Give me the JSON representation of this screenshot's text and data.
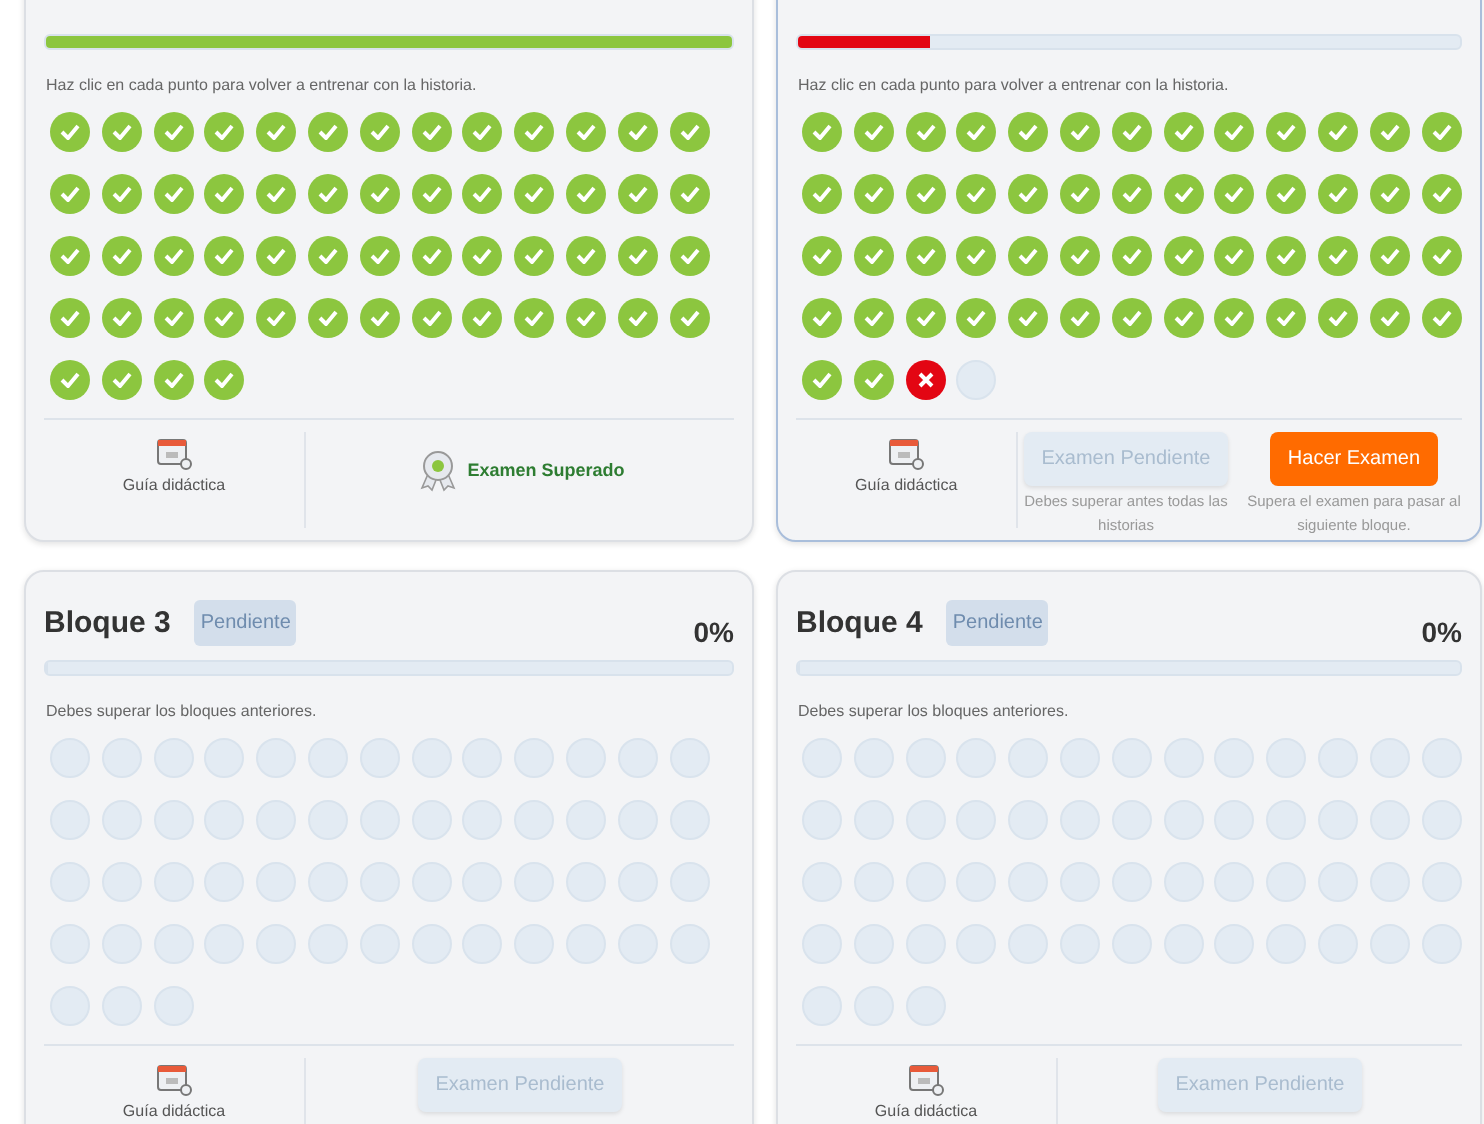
{
  "blocks": [
    {
      "selected": false,
      "progress": {
        "level": 1,
        "color": "#8cc63f"
      },
      "message": "Haz clic en cada punto para volver a entrenar con la historia.",
      "dots": [
        {
          "kind": "passed"
        },
        {
          "kind": "passed"
        },
        {
          "kind": "passed"
        },
        {
          "kind": "passed"
        },
        {
          "kind": "passed"
        },
        {
          "kind": "passed"
        },
        {
          "kind": "passed"
        },
        {
          "kind": "passed"
        },
        {
          "kind": "passed"
        },
        {
          "kind": "passed"
        },
        {
          "kind": "passed"
        },
        {
          "kind": "passed"
        },
        {
          "kind": "passed"
        },
        {
          "kind": "passed"
        },
        {
          "kind": "passed"
        },
        {
          "kind": "passed"
        },
        {
          "kind": "passed"
        },
        {
          "kind": "passed"
        },
        {
          "kind": "passed"
        },
        {
          "kind": "passed"
        },
        {
          "kind": "passed"
        },
        {
          "kind": "passed"
        },
        {
          "kind": "passed"
        },
        {
          "kind": "passed"
        },
        {
          "kind": "passed"
        },
        {
          "kind": "passed"
        },
        {
          "kind": "passed"
        },
        {
          "kind": "passed"
        },
        {
          "kind": "passed"
        },
        {
          "kind": "passed"
        },
        {
          "kind": "passed"
        },
        {
          "kind": "passed"
        },
        {
          "kind": "passed"
        },
        {
          "kind": "passed"
        },
        {
          "kind": "passed"
        },
        {
          "kind": "passed"
        },
        {
          "kind": "passed"
        },
        {
          "kind": "passed"
        },
        {
          "kind": "passed"
        },
        {
          "kind": "passed"
        },
        {
          "kind": "passed"
        },
        {
          "kind": "passed"
        },
        {
          "kind": "passed"
        },
        {
          "kind": "passed"
        },
        {
          "kind": "passed"
        },
        {
          "kind": "passed"
        },
        {
          "kind": "passed"
        },
        {
          "kind": "passed"
        },
        {
          "kind": "passed"
        },
        {
          "kind": "passed"
        },
        {
          "kind": "passed"
        },
        {
          "kind": "passed"
        },
        {
          "kind": "passed"
        },
        {
          "kind": "passed"
        },
        {
          "kind": "passed"
        },
        {
          "kind": "passed"
        }
      ],
      "guide": "Guía didáctica",
      "actions": [
        {
          "kind": "achievement",
          "label": "Examen Superado"
        }
      ]
    },
    {
      "selected": true,
      "progress": {
        "level": 0.2,
        "color": "#e30613"
      },
      "message": "Haz clic en cada punto para volver a entrenar con la historia.",
      "dots": [
        {
          "kind": "passed"
        },
        {
          "kind": "passed"
        },
        {
          "kind": "passed"
        },
        {
          "kind": "passed"
        },
        {
          "kind": "passed"
        },
        {
          "kind": "passed"
        },
        {
          "kind": "passed"
        },
        {
          "kind": "passed"
        },
        {
          "kind": "passed"
        },
        {
          "kind": "passed"
        },
        {
          "kind": "passed"
        },
        {
          "kind": "passed"
        },
        {
          "kind": "passed"
        },
        {
          "kind": "passed"
        },
        {
          "kind": "passed"
        },
        {
          "kind": "passed"
        },
        {
          "kind": "passed"
        },
        {
          "kind": "passed"
        },
        {
          "kind": "passed"
        },
        {
          "kind": "passed"
        },
        {
          "kind": "passed"
        },
        {
          "kind": "passed"
        },
        {
          "kind": "passed"
        },
        {
          "kind": "passed"
        },
        {
          "kind": "passed"
        },
        {
          "kind": "passed"
        },
        {
          "kind": "passed"
        },
        {
          "kind": "passed"
        },
        {
          "kind": "passed"
        },
        {
          "kind": "passed"
        },
        {
          "kind": "passed"
        },
        {
          "kind": "passed"
        },
        {
          "kind": "passed"
        },
        {
          "kind": "passed"
        },
        {
          "kind": "passed"
        },
        {
          "kind": "passed"
        },
        {
          "kind": "passed"
        },
        {
          "kind": "passed"
        },
        {
          "kind": "passed"
        },
        {
          "kind": "passed"
        },
        {
          "kind": "passed"
        },
        {
          "kind": "passed"
        },
        {
          "kind": "passed"
        },
        {
          "kind": "passed"
        },
        {
          "kind": "passed"
        },
        {
          "kind": "passed"
        },
        {
          "kind": "passed"
        },
        {
          "kind": "passed"
        },
        {
          "kind": "passed"
        },
        {
          "kind": "passed"
        },
        {
          "kind": "passed"
        },
        {
          "kind": "passed"
        },
        {
          "kind": "passed"
        },
        {
          "kind": "passed"
        },
        {
          "kind": "failed"
        },
        {
          "kind": "pending"
        }
      ],
      "guide": "Guía didáctica",
      "actions": [
        {
          "kind": "button",
          "disabled": true,
          "label": "Examen Pendiente",
          "note": "Debes superar antes todas las historias"
        },
        {
          "kind": "button",
          "disabled": false,
          "label": "Hacer Examen",
          "note": "Supera el examen para pasar al siguiente bloque."
        }
      ]
    },
    {
      "selected": false,
      "title": "Bloque 3",
      "badge": "Pendiente",
      "percent": "0%",
      "progress": {
        "level": 0
      },
      "message": "Debes superar los bloques anteriores.",
      "dots": [
        {
          "kind": "pending"
        },
        {
          "kind": "pending"
        },
        {
          "kind": "pending"
        },
        {
          "kind": "pending"
        },
        {
          "kind": "pending"
        },
        {
          "kind": "pending"
        },
        {
          "kind": "pending"
        },
        {
          "kind": "pending"
        },
        {
          "kind": "pending"
        },
        {
          "kind": "pending"
        },
        {
          "kind": "pending"
        },
        {
          "kind": "pending"
        },
        {
          "kind": "pending"
        },
        {
          "kind": "pending"
        },
        {
          "kind": "pending"
        },
        {
          "kind": "pending"
        },
        {
          "kind": "pending"
        },
        {
          "kind": "pending"
        },
        {
          "kind": "pending"
        },
        {
          "kind": "pending"
        },
        {
          "kind": "pending"
        },
        {
          "kind": "pending"
        },
        {
          "kind": "pending"
        },
        {
          "kind": "pending"
        },
        {
          "kind": "pending"
        },
        {
          "kind": "pending"
        },
        {
          "kind": "pending"
        },
        {
          "kind": "pending"
        },
        {
          "kind": "pending"
        },
        {
          "kind": "pending"
        },
        {
          "kind": "pending"
        },
        {
          "kind": "pending"
        },
        {
          "kind": "pending"
        },
        {
          "kind": "pending"
        },
        {
          "kind": "pending"
        },
        {
          "kind": "pending"
        },
        {
          "kind": "pending"
        },
        {
          "kind": "pending"
        },
        {
          "kind": "pending"
        },
        {
          "kind": "pending"
        },
        {
          "kind": "pending"
        },
        {
          "kind": "pending"
        },
        {
          "kind": "pending"
        },
        {
          "kind": "pending"
        },
        {
          "kind": "pending"
        },
        {
          "kind": "pending"
        },
        {
          "kind": "pending"
        },
        {
          "kind": "pending"
        },
        {
          "kind": "pending"
        },
        {
          "kind": "pending"
        },
        {
          "kind": "pending"
        },
        {
          "kind": "pending"
        },
        {
          "kind": "pending"
        },
        {
          "kind": "pending"
        },
        {
          "kind": "pending"
        }
      ],
      "guide": "Guía didáctica",
      "actions": [
        {
          "kind": "button",
          "disabled": true,
          "label": "Examen Pendiente"
        }
      ]
    },
    {
      "selected": false,
      "title": "Bloque 4",
      "badge": "Pendiente",
      "percent": "0%",
      "progress": {
        "level": 0
      },
      "message": "Debes superar los bloques anteriores.",
      "dots": [
        {
          "kind": "pending"
        },
        {
          "kind": "pending"
        },
        {
          "kind": "pending"
        },
        {
          "kind": "pending"
        },
        {
          "kind": "pending"
        },
        {
          "kind": "pending"
        },
        {
          "kind": "pending"
        },
        {
          "kind": "pending"
        },
        {
          "kind": "pending"
        },
        {
          "kind": "pending"
        },
        {
          "kind": "pending"
        },
        {
          "kind": "pending"
        },
        {
          "kind": "pending"
        },
        {
          "kind": "pending"
        },
        {
          "kind": "pending"
        },
        {
          "kind": "pending"
        },
        {
          "kind": "pending"
        },
        {
          "kind": "pending"
        },
        {
          "kind": "pending"
        },
        {
          "kind": "pending"
        },
        {
          "kind": "pending"
        },
        {
          "kind": "pending"
        },
        {
          "kind": "pending"
        },
        {
          "kind": "pending"
        },
        {
          "kind": "pending"
        },
        {
          "kind": "pending"
        },
        {
          "kind": "pending"
        },
        {
          "kind": "pending"
        },
        {
          "kind": "pending"
        },
        {
          "kind": "pending"
        },
        {
          "kind": "pending"
        },
        {
          "kind": "pending"
        },
        {
          "kind": "pending"
        },
        {
          "kind": "pending"
        },
        {
          "kind": "pending"
        },
        {
          "kind": "pending"
        },
        {
          "kind": "pending"
        },
        {
          "kind": "pending"
        },
        {
          "kind": "pending"
        },
        {
          "kind": "pending"
        },
        {
          "kind": "pending"
        },
        {
          "kind": "pending"
        },
        {
          "kind": "pending"
        },
        {
          "kind": "pending"
        },
        {
          "kind": "pending"
        },
        {
          "kind": "pending"
        },
        {
          "kind": "pending"
        },
        {
          "kind": "pending"
        },
        {
          "kind": "pending"
        },
        {
          "kind": "pending"
        },
        {
          "kind": "pending"
        },
        {
          "kind": "pending"
        },
        {
          "kind": "pending"
        },
        {
          "kind": "pending"
        },
        {
          "kind": "pending"
        }
      ],
      "guide": "Guía didáctica",
      "actions": [
        {
          "kind": "button",
          "disabled": true,
          "label": "Examen Pendiente"
        }
      ]
    }
  ]
}
